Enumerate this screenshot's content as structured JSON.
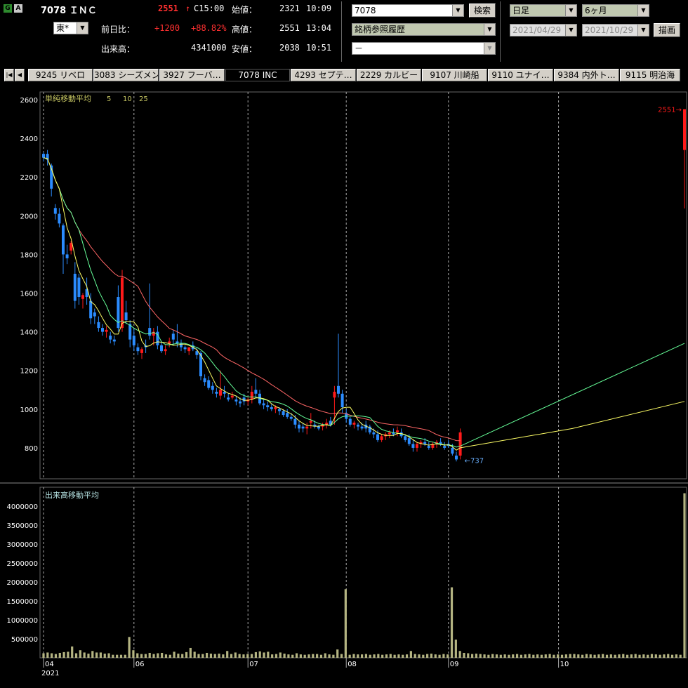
{
  "header": {
    "badge_g": "G",
    "badge_a": "A",
    "symbol_title": "7078 ＩＮＣ",
    "market": "東*",
    "last_price": "2551",
    "last_arrow": "↑",
    "last_time": "C15:00",
    "change_label": "前日比：",
    "change_value": "+1200",
    "change_pct": "+88.82%",
    "volume_label": "出来高：",
    "volume_value": "4341000",
    "open_label": "始値：",
    "open_value": "2321",
    "open_time": "10:09",
    "high_label": "高値：",
    "high_value": "2551",
    "high_time": "13:04",
    "low_label": "安値：",
    "low_value": "2038",
    "low_time": "10:51",
    "code_input": "7078",
    "search_button": "検索",
    "history_select": "銘柄参照履歴",
    "blank_select": "－",
    "period_select": "日足",
    "range_select": "6ヶ月",
    "date_from": "2021/04/29",
    "date_to": "2021/10/29",
    "draw_button": "描画"
  },
  "tabs": [
    {
      "label": "9245 リベロ"
    },
    {
      "label": "3083 シーズメン"
    },
    {
      "label": "3927 フーバ…"
    },
    {
      "label": "7078 INC"
    },
    {
      "label": "4293 セプテ…"
    },
    {
      "label": "2229 カルビー"
    },
    {
      "label": "9107 川崎船"
    },
    {
      "label": "9110 ユナイ…"
    },
    {
      "label": "9384 内外ト…"
    },
    {
      "label": "9115 明治海"
    }
  ],
  "colors": {
    "up": "#ff1a1a",
    "down": "#2b8cff",
    "ma5": "#ffff66",
    "ma10": "#66ff99",
    "ma25": "#ff6666",
    "volume": "#b4b482",
    "grid": "#666666",
    "axis_text": "#ffffff"
  },
  "chart_data": {
    "type": "candlestick",
    "price_legend": "単純移動平均",
    "ma_periods": [
      "5",
      "10",
      "25"
    ],
    "volume_legend": "出来高移動平均",
    "ylim": [
      640,
      2640
    ],
    "yticks": [
      800,
      1000,
      1200,
      1400,
      1600,
      1800,
      2000,
      2200,
      2400,
      2600
    ],
    "vol_ylim": [
      0,
      4500000
    ],
    "vol_yticks": [
      500000,
      1000000,
      1500000,
      2000000,
      2500000,
      3000000,
      3500000,
      4000000
    ],
    "x_tick_labels": [
      "04",
      "06",
      "07",
      "08",
      "09",
      "10"
    ],
    "x_tick_index": [
      0,
      23,
      52,
      77,
      103,
      131
    ],
    "year_label": "2021",
    "high_marker": "2551",
    "low_marker": "737",
    "ohlc": [
      [
        2320,
        2330,
        2280,
        2300
      ],
      [
        2320,
        2340,
        2260,
        2290
      ],
      [
        2260,
        2270,
        2100,
        2140
      ],
      [
        2040,
        2060,
        1980,
        2010
      ],
      [
        2010,
        2040,
        1940,
        1960
      ],
      [
        1950,
        1960,
        1700,
        1800
      ],
      [
        1800,
        1850,
        1750,
        1780
      ],
      [
        1820,
        1870,
        1800,
        1860
      ],
      [
        1700,
        1760,
        1520,
        1560
      ],
      [
        1680,
        1700,
        1540,
        1580
      ],
      [
        1570,
        1600,
        1520,
        1590
      ],
      [
        1620,
        1680,
        1540,
        1580
      ],
      [
        1560,
        1600,
        1440,
        1470
      ],
      [
        1500,
        1520,
        1440,
        1480
      ],
      [
        1450,
        1480,
        1400,
        1420
      ],
      [
        1420,
        1440,
        1380,
        1400
      ],
      [
        1400,
        1430,
        1370,
        1410
      ],
      [
        1380,
        1400,
        1340,
        1360
      ],
      [
        1360,
        1380,
        1330,
        1350
      ],
      [
        1580,
        1640,
        1400,
        1420
      ],
      [
        1420,
        1720,
        1400,
        1680
      ],
      [
        1500,
        1560,
        1440,
        1460
      ],
      [
        1440,
        1460,
        1320,
        1360
      ],
      [
        1380,
        1420,
        1300,
        1330
      ],
      [
        1320,
        1340,
        1280,
        1300
      ],
      [
        1290,
        1320,
        1260,
        1310
      ],
      [
        1330,
        1360,
        1290,
        1320
      ],
      [
        1420,
        1650,
        1360,
        1380
      ],
      [
        1380,
        1420,
        1330,
        1400
      ],
      [
        1400,
        1430,
        1310,
        1330
      ],
      [
        1330,
        1350,
        1290,
        1300
      ],
      [
        1300,
        1330,
        1280,
        1310
      ],
      [
        1340,
        1370,
        1320,
        1350
      ],
      [
        1390,
        1410,
        1330,
        1360
      ],
      [
        1350,
        1440,
        1320,
        1340
      ],
      [
        1340,
        1360,
        1300,
        1320
      ],
      [
        1320,
        1330,
        1290,
        1310
      ],
      [
        1300,
        1320,
        1280,
        1320
      ],
      [
        1330,
        1350,
        1300,
        1310
      ],
      [
        1300,
        1320,
        1260,
        1280
      ],
      [
        1290,
        1300,
        1150,
        1170
      ],
      [
        1160,
        1180,
        1120,
        1140
      ],
      [
        1150,
        1170,
        1100,
        1110
      ],
      [
        1120,
        1140,
        1080,
        1100
      ],
      [
        1090,
        1110,
        1060,
        1080
      ],
      [
        1070,
        1200,
        1050,
        1100
      ],
      [
        1090,
        1120,
        1060,
        1080
      ],
      [
        1060,
        1080,
        1040,
        1050
      ],
      [
        1060,
        1090,
        1050,
        1070
      ],
      [
        1050,
        1070,
        1020,
        1040
      ],
      [
        1040,
        1060,
        1010,
        1030
      ],
      [
        1060,
        1080,
        1020,
        1040
      ],
      [
        1040,
        1060,
        1020,
        1050
      ],
      [
        1050,
        1120,
        1030,
        1090
      ],
      [
        1100,
        1160,
        1060,
        1080
      ],
      [
        1080,
        1100,
        1020,
        1030
      ],
      [
        1030,
        1050,
        1000,
        1020
      ],
      [
        1020,
        1040,
        990,
        1010
      ],
      [
        1010,
        1030,
        990,
        1000
      ],
      [
        1000,
        1020,
        980,
        1010
      ],
      [
        1000,
        1010,
        970,
        990
      ],
      [
        990,
        1000,
        960,
        970
      ],
      [
        980,
        1000,
        950,
        960
      ],
      [
        960,
        980,
        940,
        950
      ],
      [
        950,
        970,
        900,
        920
      ],
      [
        920,
        940,
        880,
        900
      ],
      [
        910,
        930,
        880,
        900
      ],
      [
        900,
        930,
        870,
        910
      ],
      [
        930,
        980,
        900,
        940
      ],
      [
        920,
        940,
        900,
        910
      ],
      [
        910,
        920,
        890,
        900
      ],
      [
        910,
        930,
        890,
        920
      ],
      [
        920,
        950,
        900,
        930
      ],
      [
        940,
        960,
        910,
        920
      ],
      [
        1060,
        1120,
        920,
        1090
      ],
      [
        1120,
        1390,
        1060,
        1080
      ],
      [
        1080,
        1100,
        980,
        1010
      ],
      [
        980,
        1000,
        930,
        950
      ],
      [
        950,
        960,
        910,
        920
      ],
      [
        920,
        940,
        900,
        930
      ],
      [
        920,
        930,
        890,
        910
      ],
      [
        910,
        930,
        890,
        900
      ],
      [
        920,
        940,
        880,
        900
      ],
      [
        910,
        920,
        870,
        880
      ],
      [
        880,
        900,
        850,
        870
      ],
      [
        870,
        890,
        830,
        840
      ],
      [
        840,
        870,
        830,
        860
      ],
      [
        860,
        880,
        840,
        870
      ],
      [
        870,
        890,
        850,
        880
      ],
      [
        880,
        900,
        860,
        870
      ],
      [
        880,
        910,
        860,
        890
      ],
      [
        880,
        900,
        850,
        860
      ],
      [
        860,
        870,
        830,
        840
      ],
      [
        850,
        870,
        810,
        820
      ],
      [
        820,
        840,
        780,
        800
      ],
      [
        800,
        830,
        780,
        820
      ],
      [
        820,
        840,
        800,
        830
      ],
      [
        830,
        850,
        810,
        820
      ],
      [
        810,
        830,
        790,
        800
      ],
      [
        800,
        830,
        790,
        820
      ],
      [
        820,
        840,
        800,
        830
      ],
      [
        830,
        850,
        810,
        820
      ],
      [
        810,
        830,
        790,
        800
      ],
      [
        820,
        840,
        800,
        810
      ],
      [
        800,
        820,
        760,
        770
      ],
      [
        760,
        780,
        730,
        740
      ],
      [
        760,
        900,
        740,
        880
      ]
    ],
    "last_candle": [
      2340,
      2551,
      2038,
      2551
    ],
    "ma5_extension": [
      900,
      1040
    ],
    "ma10_extension": [
      1340
    ],
    "volume": [
      120000,
      140000,
      120000,
      100000,
      130000,
      150000,
      160000,
      300000,
      120000,
      200000,
      140000,
      110000,
      180000,
      140000,
      140000,
      110000,
      120000,
      80000,
      80000,
      80000,
      80000,
      550000,
      200000,
      120000,
      100000,
      100000,
      130000,
      100000,
      120000,
      130000,
      90000,
      80000,
      160000,
      110000,
      100000,
      150000,
      260000,
      160000,
      100000,
      100000,
      130000,
      110000,
      100000,
      110000,
      90000,
      180000,
      100000,
      140000,
      100000,
      90000,
      100000,
      100000,
      150000,
      170000,
      140000,
      160000,
      90000,
      100000,
      140000,
      110000,
      90000,
      80000,
      120000,
      90000,
      80000,
      90000,
      100000,
      100000,
      80000,
      120000,
      90000,
      80000,
      220000,
      100000,
      1810000,
      80000,
      100000,
      90000,
      90000,
      100000,
      80000,
      90000,
      100000,
      80000,
      90000,
      100000,
      80000,
      90000,
      80000,
      90000,
      180000,
      100000,
      90000,
      80000,
      100000,
      110000,
      90000,
      80000,
      100000,
      90000,
      1860000,
      480000,
      180000,
      130000,
      120000,
      100000,
      110000,
      100000,
      90000,
      80000,
      100000,
      90000,
      80000,
      90000,
      80000,
      90000,
      100000,
      80000,
      90000,
      100000,
      80000,
      90000,
      80000,
      90000,
      100000,
      80000,
      90000,
      80000,
      90000,
      100000,
      100000,
      90000,
      80000,
      100000,
      90000,
      80000,
      90000,
      100000,
      80000,
      90000,
      80000,
      90000,
      100000,
      80000,
      90000,
      100000,
      80000,
      90000,
      80000,
      100000,
      90000,
      80000,
      90000,
      100000,
      80000,
      90000,
      80000,
      4341000
    ]
  }
}
